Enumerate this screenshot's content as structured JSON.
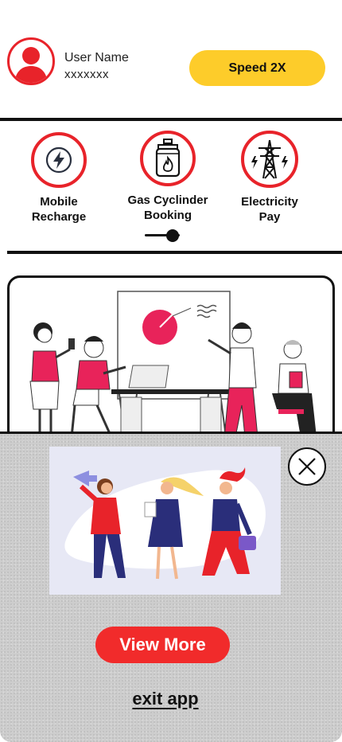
{
  "header": {
    "user_name": "User Name",
    "user_id": "xxxxxxx",
    "speed_button": "Speed 2X"
  },
  "services": [
    {
      "label": "Mobile\nRecharge",
      "icon": "lightning-bolt-icon"
    },
    {
      "label": "Gas  Cyclinder\nBooking",
      "icon": "gas-cylinder-icon"
    },
    {
      "label": "Electricity\nPay",
      "icon": "power-tower-icon"
    }
  ],
  "carousel": {
    "position": 0.8
  },
  "promo": {
    "view_more": "View More",
    "exit_app": "exit app"
  },
  "colors": {
    "accent_red": "#e8232a",
    "button_red": "#f12b2b",
    "speed_yellow": "#fdcc2a",
    "sheet_gray": "#cdcdcd"
  }
}
